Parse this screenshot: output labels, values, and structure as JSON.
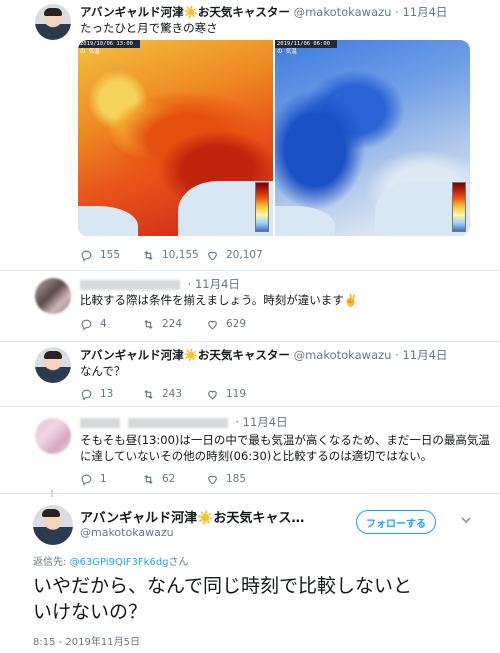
{
  "tweet1": {
    "name": "アバンギャルド河津☀️お天気キャスター",
    "handle": "@makotokawazu",
    "time": "11月4日",
    "text": "たったひと月で驚きの寒さ",
    "map_left_label": "2019/10/06 13:00 の 気温",
    "map_right_label": "2019/11/06 06:00 の 気温",
    "replies": "155",
    "retweets": "10,155",
    "likes": "20,107"
  },
  "reply1": {
    "time": "11月4日",
    "text": "比較する際は条件を揃えましょう。時刻が違います✌️",
    "replies": "4",
    "retweets": "224",
    "likes": "629"
  },
  "tweet2": {
    "name": "アバンギャルド河津☀️お天気キャスター",
    "handle": "@makotokawazu",
    "time": "11月4日",
    "text": "なんで？",
    "replies": "13",
    "retweets": "243",
    "likes": "119"
  },
  "reply2": {
    "time": "11月4日",
    "text_line1": "そもそも昼(13:00)は一日の中で最も気温が高くなるため、まだ一日の最高気温",
    "text_line2": "に達していないその他の時刻(06:30)と比較するのは適切ではない。",
    "replies": "1",
    "retweets": "62",
    "likes": "185"
  },
  "main_tweet": {
    "name": "アバンギャルド河津☀️お天気キャス…",
    "handle": "@makotokawazu",
    "follow_label": "フォローする",
    "reply_to_label": "返信先:",
    "reply_to_handle": "@63GPi9QIF3Fk6dg",
    "reply_to_suffix": "さん",
    "text_line1": "いやだから、なんで同じ時刻で比較しないと",
    "text_line2": "いけないの？",
    "timestamp": "8:15 - 2019年11月5日"
  },
  "colors": {
    "accent": "#1da1f2",
    "muted": "#657786",
    "text": "#14171a"
  }
}
